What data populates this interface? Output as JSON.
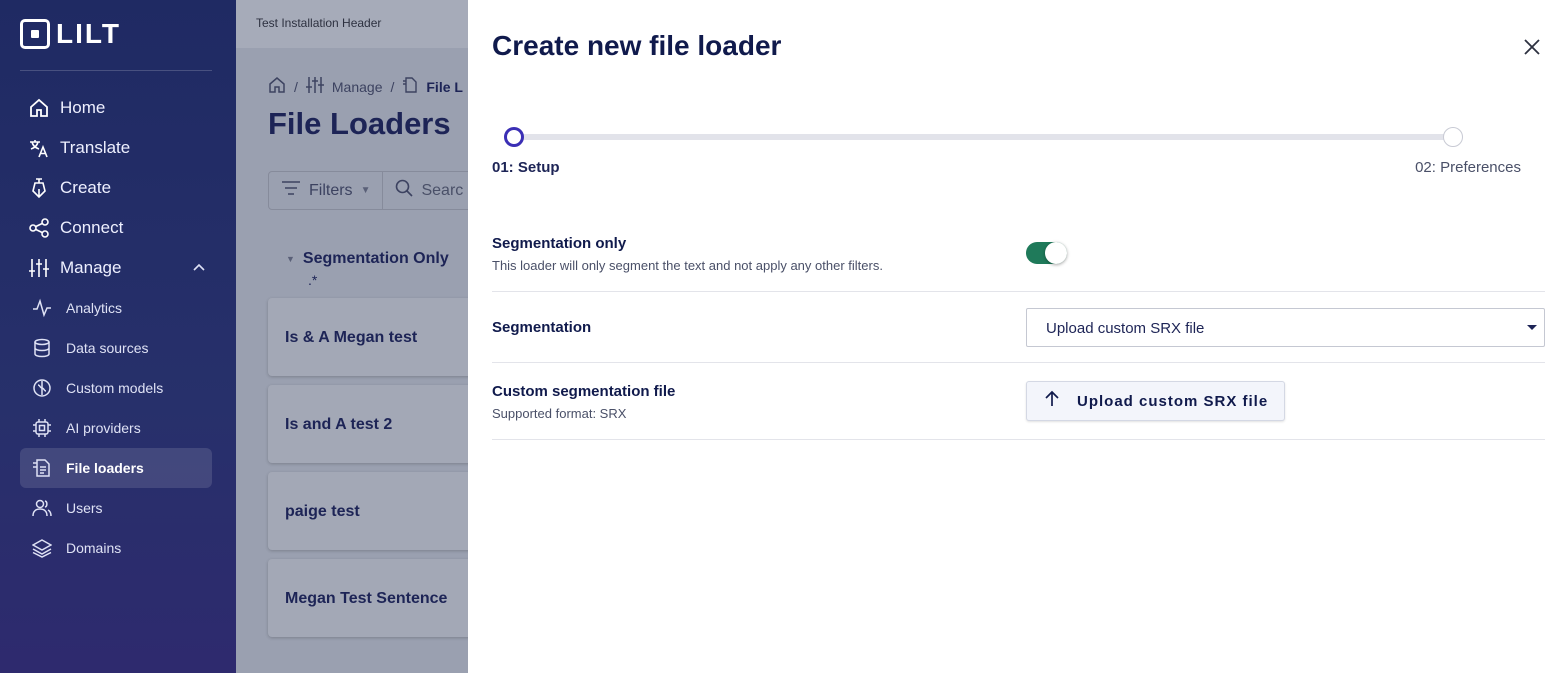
{
  "sidebar": {
    "logo": "LILT",
    "nav": [
      {
        "label": "Home",
        "icon": "home-icon"
      },
      {
        "label": "Translate",
        "icon": "translate-icon"
      },
      {
        "label": "Create",
        "icon": "pen-icon"
      },
      {
        "label": "Connect",
        "icon": "share-icon"
      },
      {
        "label": "Manage",
        "icon": "sliders-icon"
      }
    ],
    "manage_items": [
      {
        "label": "Analytics",
        "icon": "analytics-icon"
      },
      {
        "label": "Data sources",
        "icon": "database-icon"
      },
      {
        "label": "Custom models",
        "icon": "brain-icon"
      },
      {
        "label": "AI providers",
        "icon": "chip-icon"
      },
      {
        "label": "File loaders",
        "icon": "file-loader-icon",
        "active": true
      },
      {
        "label": "Users",
        "icon": "users-icon"
      },
      {
        "label": "Domains",
        "icon": "layers-icon"
      }
    ]
  },
  "background_page": {
    "header": "Test Installation Header",
    "breadcrumb": {
      "manage": "Manage",
      "current": "File L"
    },
    "title": "File Loaders",
    "filters_label": "Filters",
    "search_placeholder": "Searc",
    "group": {
      "name": "Segmentation Only",
      "pattern": ".*"
    },
    "cards": [
      "Is & A Megan test",
      "Is and A test 2",
      "paige test",
      "Megan Test Sentence"
    ]
  },
  "drawer": {
    "title": "Create new file loader",
    "steps": {
      "step1": "01: Setup",
      "step2": "02: Preferences",
      "current": 1
    },
    "segmentation_only": {
      "label": "Segmentation only",
      "description": "This loader will only segment the text and not apply any other filters.",
      "enabled": true
    },
    "segmentation": {
      "label": "Segmentation",
      "selected": "Upload custom SRX file"
    },
    "custom_file": {
      "label": "Custom segmentation file",
      "description": "Supported format: SRX",
      "button_label": "Upload custom SRX file"
    }
  },
  "colors": {
    "sidebar": "#1f2a63",
    "toggle_on": "#1f7a5a",
    "step_active": "#3b2fb5",
    "title": "#101a4c"
  }
}
